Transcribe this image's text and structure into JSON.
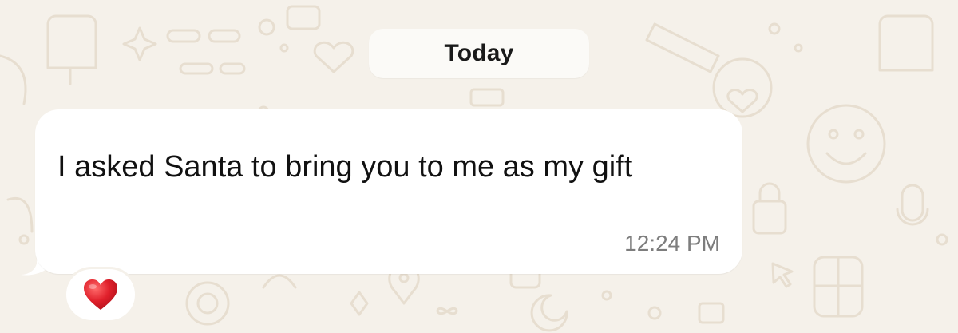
{
  "chat": {
    "date_separator": "Today",
    "message": {
      "text": "I asked Santa to bring you to me as my gift",
      "time": "12:24 PM",
      "reaction": "heart-icon"
    }
  },
  "colors": {
    "wallpaper": "#f5f1ea",
    "doodle": "#e7ded0",
    "bubble": "#ffffff",
    "chip": "#fbfaf7",
    "heart": "#e0202b",
    "time_text": "#7d7d7d"
  }
}
